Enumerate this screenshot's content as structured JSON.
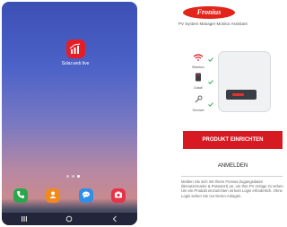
{
  "home_screen": {
    "app_shortcut": {
      "label": "Solar.web live",
      "icon": "solar-web-icon",
      "color": "#e41e26"
    },
    "page_indicator": {
      "pages": 3,
      "active": 3
    },
    "dock": [
      {
        "name": "phone",
        "icon": "phone-icon",
        "color": "#2aa64c"
      },
      {
        "name": "contacts",
        "icon": "contacts-icon",
        "color": "#f08a1c"
      },
      {
        "name": "messages",
        "icon": "messages-icon",
        "color": "#2f8ee6"
      },
      {
        "name": "camera",
        "icon": "camera-icon",
        "color": "#e6334a"
      }
    ],
    "nav_bar": [
      "recents-icon",
      "home-icon",
      "back-icon"
    ]
  },
  "app": {
    "logo_text": "Fronius",
    "brand_color": "#e3241b",
    "tagline": "PV System Manager Monitor Assistant",
    "devices": [
      {
        "label": "Wlanbox",
        "icon": "wifi-icon"
      },
      {
        "label": "Datalt",
        "icon": "datamanager-icon"
      },
      {
        "label": "Servicet",
        "icon": "service-icon"
      }
    ],
    "primary_button": "PRODUKT EINRICHTEN",
    "secondary_button": "ANMELDEN",
    "info_text": "Melden Sie sich mit Ihrem Fronius Zugangsdaten (Benutzername & Passwort) an, um Ihre PV Anlage zu sehen. Um ein Produkt einzurichten ist kein Login erforderlich. Ohne Login sehen Sie nur Demo-Anlagen."
  }
}
